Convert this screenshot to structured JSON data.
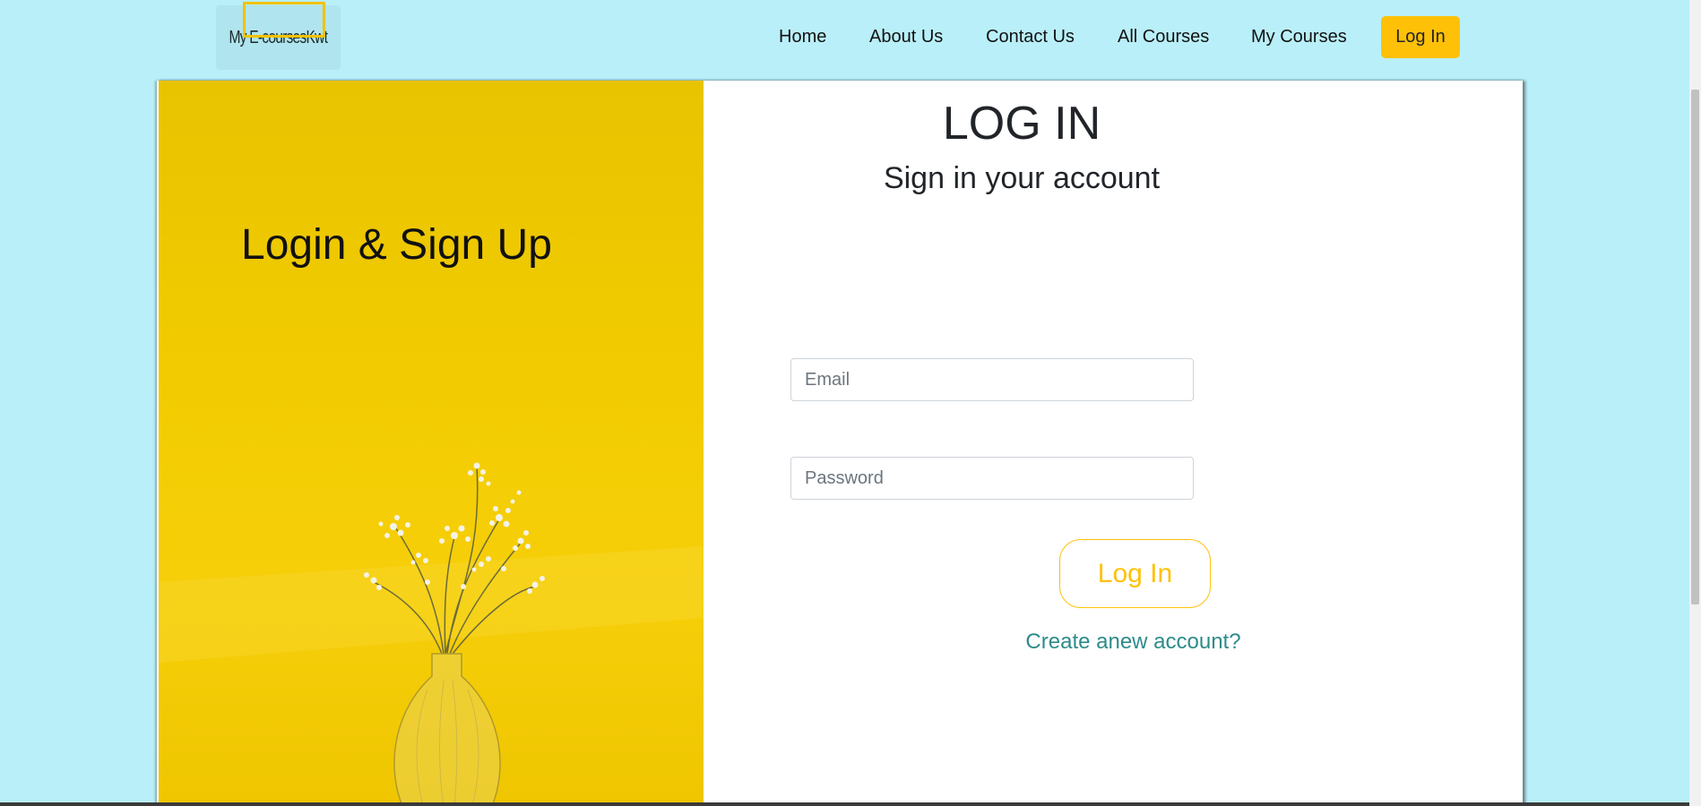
{
  "navbar": {
    "logo_text": "My E-coursesKwt",
    "links": [
      "Home",
      "About Us",
      "Contact Us",
      "All Courses",
      "My Courses"
    ],
    "login_label": "Log In"
  },
  "left_panel": {
    "title": "Login & Sign Up"
  },
  "form": {
    "title": "LOG IN",
    "subtitle": "Sign in your account",
    "email_placeholder": "Email",
    "password_placeholder": "Password",
    "submit_label": "Log In",
    "create_account_label": "Create anew account?"
  },
  "colors": {
    "background": "#b9eff8",
    "accent": "#ffc107",
    "panel_yellow": "#f2cc00",
    "link": "#2e8b8b"
  }
}
